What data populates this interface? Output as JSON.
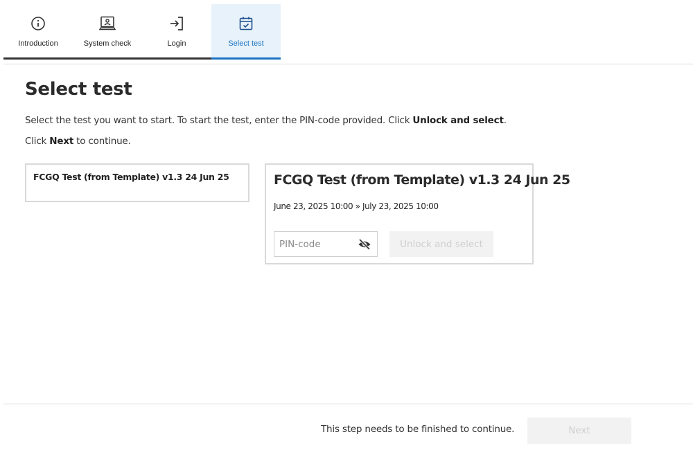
{
  "stepper": {
    "steps": [
      {
        "label": "Introduction",
        "icon": "info-icon",
        "state": "complete"
      },
      {
        "label": "System check",
        "icon": "laptop-user-icon",
        "state": "complete"
      },
      {
        "label": "Login",
        "icon": "login-icon",
        "state": "complete"
      },
      {
        "label": "Select test",
        "icon": "calendar-check-icon",
        "state": "active"
      }
    ]
  },
  "main": {
    "title": "Select test",
    "instruction1_text": "Select the test you want to start. To start the test, enter the PIN-code provided. Click ",
    "instruction1_bold": "Unlock and select",
    "instruction1_end": ".",
    "instruction2_start": "Click ",
    "instruction2_bold": "Next",
    "instruction2_end": " to continue."
  },
  "test_list": [
    {
      "name": "FCGQ Test (from Template) v1.3 24 Jun 25"
    }
  ],
  "detail": {
    "title": "FCGQ Test (from Template) v1.3 24 Jun 25",
    "dates": "June 23, 2025 10:00 » July 23, 2025 10:00",
    "pin_placeholder": "PIN-code",
    "pin_value": "",
    "unlock_label": "Unlock and select"
  },
  "footer": {
    "message": "This step needs to be finished to continue.",
    "next_label": "Next"
  },
  "colors": {
    "accent": "#1a73c2",
    "active_tab_bg": "#e8f2fb",
    "completed_bar": "#333333",
    "disabled_bg": "#f2f2f2",
    "disabled_text": "#cfcfcf"
  }
}
